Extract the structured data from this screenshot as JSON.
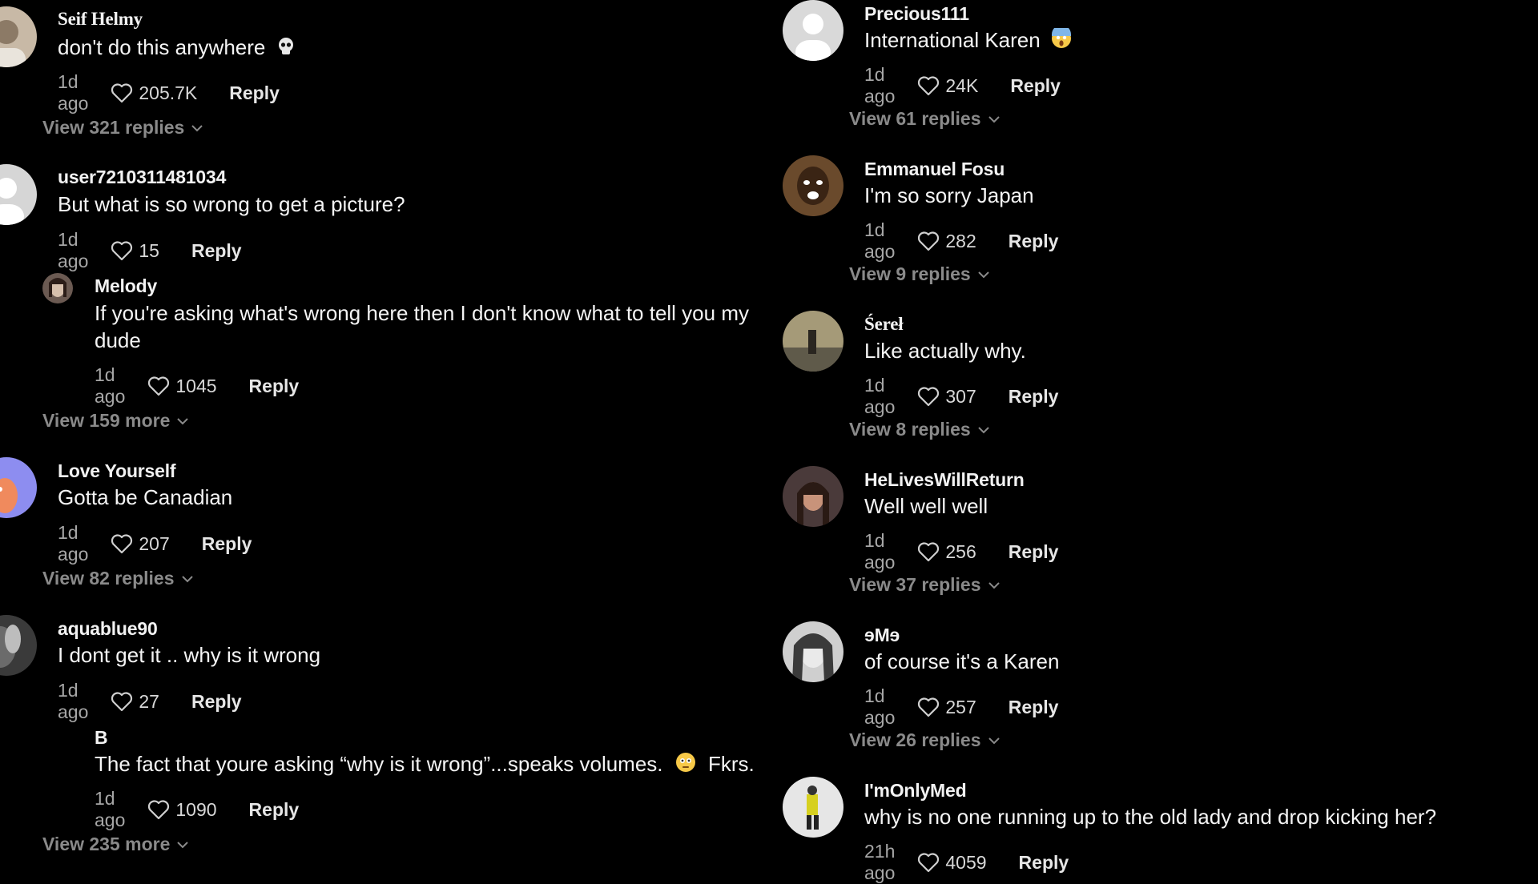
{
  "left": {
    "c1": {
      "user": "Seif Helmy",
      "text": "don't do this anywhere",
      "time": "1d ago",
      "likes": "205.7K",
      "reply": "Reply"
    },
    "v1": "View 321 replies",
    "c2": {
      "user": "user7210311481034",
      "text": "But what is so wrong to get a picture?",
      "time": "1d ago",
      "likes": "15",
      "reply": "Reply"
    },
    "r2": {
      "user": "Melody",
      "text": "If you're asking what's wrong here then I don't know what to tell you my dude",
      "time": "1d ago",
      "likes": "1045",
      "reply": "Reply"
    },
    "v2": "View 159 more",
    "c3": {
      "user": "Love Yourself",
      "text": "Gotta be Canadian",
      "time": "1d ago",
      "likes": "207",
      "reply": "Reply"
    },
    "v3": "View 82 replies",
    "c4": {
      "user": "aquablue90",
      "text": "I dont get it .. why is it wrong",
      "time": "1d ago",
      "likes": "27",
      "reply": "Reply"
    },
    "r4": {
      "user": "B",
      "text": "The fact that youre asking “why is it wrong”...speaks volumes.",
      "text2": "Fkrs.",
      "time": "1d ago",
      "likes": "1090",
      "reply": "Reply"
    },
    "v4": "View 235 more"
  },
  "right": {
    "c1": {
      "user": "Precious111",
      "text": "International Karen",
      "time": "1d ago",
      "likes": "24K",
      "reply": "Reply"
    },
    "v1": "View 61 replies",
    "c2": {
      "user": "Emmanuel Fosu",
      "text": "I'm so sorry Japan",
      "time": "1d ago",
      "likes": "282",
      "reply": "Reply"
    },
    "v2": "View 9 replies",
    "c3": {
      "user": "Śereł",
      "text": "Like actually why.",
      "time": "1d ago",
      "likes": "307",
      "reply": "Reply"
    },
    "v3": "View 8 replies",
    "c4": {
      "user": "HeLivesWillReturn",
      "text": "Well well well",
      "time": "1d ago",
      "likes": "256",
      "reply": "Reply"
    },
    "v4": "View 37 replies",
    "c5": {
      "user": "ɘMɘ",
      "text": "of course it's a Karen",
      "time": "1d ago",
      "likes": "257",
      "reply": "Reply"
    },
    "v5": "View 26 replies",
    "c6": {
      "user": "I'mOnlyMed",
      "text": "why is no one running up to the old lady and drop kicking her?",
      "time": "21h ago",
      "likes": "4059",
      "reply": "Reply"
    }
  },
  "colors": {
    "background": "#000000",
    "text": "#f4f4f4",
    "muted": "#a6a6a6",
    "view_link": "#8a8a8a"
  },
  "icons": [
    "heart-icon",
    "chevron-down-icon",
    "skull-emoji",
    "scream-emoji",
    "flushed-emoji"
  ]
}
